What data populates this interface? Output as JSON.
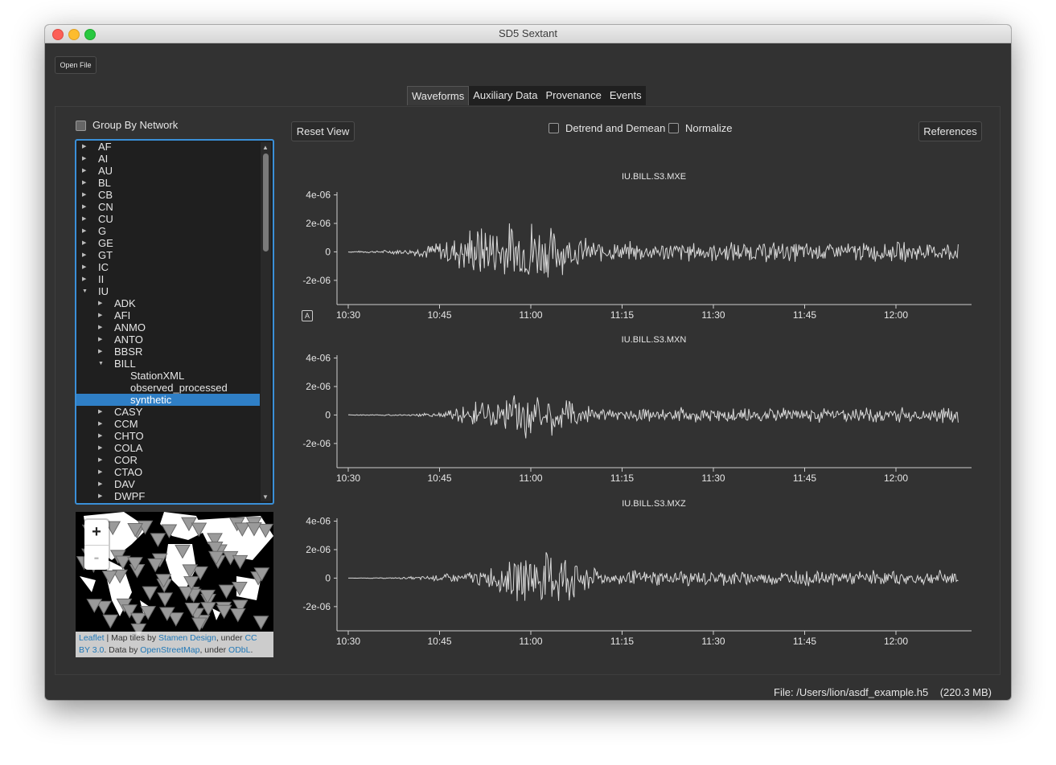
{
  "window": {
    "title": "SD5 Sextant"
  },
  "toolbar": {
    "open_file": "Open File"
  },
  "tabs": [
    "Waveforms",
    "Auxiliary Data",
    "Provenance",
    "Events"
  ],
  "sidebar": {
    "group_by_network": "Group By Network",
    "tree": [
      {
        "label": "AF",
        "level": 0,
        "state": "collapsed"
      },
      {
        "label": "AI",
        "level": 0,
        "state": "collapsed"
      },
      {
        "label": "AU",
        "level": 0,
        "state": "collapsed"
      },
      {
        "label": "BL",
        "level": 0,
        "state": "collapsed"
      },
      {
        "label": "CB",
        "level": 0,
        "state": "collapsed"
      },
      {
        "label": "CN",
        "level": 0,
        "state": "collapsed"
      },
      {
        "label": "CU",
        "level": 0,
        "state": "collapsed"
      },
      {
        "label": "G",
        "level": 0,
        "state": "collapsed"
      },
      {
        "label": "GE",
        "level": 0,
        "state": "collapsed"
      },
      {
        "label": "GT",
        "level": 0,
        "state": "collapsed"
      },
      {
        "label": "IC",
        "level": 0,
        "state": "collapsed"
      },
      {
        "label": "II",
        "level": 0,
        "state": "collapsed"
      },
      {
        "label": "IU",
        "level": 0,
        "state": "expanded"
      },
      {
        "label": "ADK",
        "level": 1,
        "state": "collapsed"
      },
      {
        "label": "AFI",
        "level": 1,
        "state": "collapsed"
      },
      {
        "label": "ANMO",
        "level": 1,
        "state": "collapsed"
      },
      {
        "label": "ANTO",
        "level": 1,
        "state": "collapsed"
      },
      {
        "label": "BBSR",
        "level": 1,
        "state": "collapsed"
      },
      {
        "label": "BILL",
        "level": 1,
        "state": "expanded"
      },
      {
        "label": "StationXML",
        "level": 2,
        "state": "leaf"
      },
      {
        "label": "observed_processed",
        "level": 2,
        "state": "leaf"
      },
      {
        "label": "synthetic",
        "level": 2,
        "state": "leaf",
        "selected": true
      },
      {
        "label": "CASY",
        "level": 1,
        "state": "collapsed"
      },
      {
        "label": "CCM",
        "level": 1,
        "state": "collapsed"
      },
      {
        "label": "CHTO",
        "level": 1,
        "state": "collapsed"
      },
      {
        "label": "COLA",
        "level": 1,
        "state": "collapsed"
      },
      {
        "label": "COR",
        "level": 1,
        "state": "collapsed"
      },
      {
        "label": "CTAO",
        "level": 1,
        "state": "collapsed"
      },
      {
        "label": "DAV",
        "level": 1,
        "state": "collapsed"
      },
      {
        "label": "DWPF",
        "level": 1,
        "state": "collapsed"
      }
    ]
  },
  "map": {
    "zoom_in": "+",
    "zoom_out": "-",
    "attribution": {
      "leaflet": "Leaflet",
      "sep": " | Map tiles by ",
      "stamen": "Stamen Design",
      "under1": ", under ",
      "cc": "CC BY 3.0",
      "data_by": ". Data by ",
      "osm": "OpenStreetMap",
      "under2": ", under ",
      "odbl": "ODbL",
      "end": "."
    }
  },
  "controls": {
    "reset_view": "Reset View",
    "detrend": "Detrend and Demean",
    "normalize": "Normalize",
    "references": "References"
  },
  "plot_badge": "A",
  "chart_data": [
    {
      "type": "line",
      "title": "IU.BILL.S3.MXE",
      "x_ticks": [
        "10:30",
        "10:45",
        "11:00",
        "11:15",
        "11:30",
        "11:45",
        "12:00"
      ],
      "y_ticks": [
        "4e-06",
        "2e-06",
        "0",
        "-2e-06"
      ],
      "ylim": [
        -3.7e-06,
        4.2e-06
      ],
      "series": [
        {
          "envelope": [
            [
              0,
              0.05
            ],
            [
              5,
              0.1
            ],
            [
              8,
              0.2
            ],
            [
              12,
              0.4
            ],
            [
              14,
              0.8
            ],
            [
              16,
              1.0
            ],
            [
              18,
              1.5
            ],
            [
              20,
              2.0
            ],
            [
              23,
              2.5
            ],
            [
              25,
              2.2
            ],
            [
              28,
              2.5
            ],
            [
              30,
              3.2
            ],
            [
              32,
              2.3
            ],
            [
              36,
              1.5
            ],
            [
              40,
              1.0
            ],
            [
              42,
              0.8
            ]
          ]
        }
      ]
    },
    {
      "type": "line",
      "title": "IU.BILL.S3.MXN",
      "x_ticks": [
        "10:30",
        "10:45",
        "11:00",
        "11:15",
        "11:30",
        "11:45",
        "12:00"
      ],
      "y_ticks": [
        "4e-06",
        "2e-06",
        "0",
        "-2e-06"
      ],
      "ylim": [
        -3.7e-06,
        4.2e-06
      ],
      "series": [
        {
          "envelope": [
            [
              0,
              0.03
            ],
            [
              8,
              0.05
            ],
            [
              12,
              0.1
            ],
            [
              16,
              0.3
            ],
            [
              18,
              0.6
            ],
            [
              20,
              0.9
            ],
            [
              24,
              1.2
            ],
            [
              28,
              1.6
            ],
            [
              30,
              2.0
            ],
            [
              32,
              1.7
            ],
            [
              36,
              1.3
            ],
            [
              40,
              0.8
            ],
            [
              42,
              0.6
            ]
          ]
        }
      ]
    },
    {
      "type": "line",
      "title": "IU.BILL.S3.MXZ",
      "x_ticks": [
        "10:30",
        "10:45",
        "11:00",
        "11:15",
        "11:30",
        "11:45",
        "12:00"
      ],
      "y_ticks": [
        "4e-06",
        "2e-06",
        "0",
        "-2e-06"
      ],
      "ylim": [
        -3.7e-06,
        4.2e-06
      ],
      "series": [
        {
          "envelope": [
            [
              0,
              0.0
            ],
            [
              8,
              0.05
            ],
            [
              10,
              0.1
            ],
            [
              14,
              0.2
            ],
            [
              18,
              0.4
            ],
            [
              20,
              0.6
            ],
            [
              24,
              1.0
            ],
            [
              28,
              1.8
            ],
            [
              30,
              2.3
            ],
            [
              32,
              2.0
            ],
            [
              36,
              2.2
            ],
            [
              38,
              1.6
            ],
            [
              40,
              0.8
            ],
            [
              42,
              0.6
            ]
          ]
        }
      ]
    }
  ],
  "status": {
    "file": "File: /Users/lion/asdf_example.h5",
    "size": "(220.3 MB)"
  }
}
